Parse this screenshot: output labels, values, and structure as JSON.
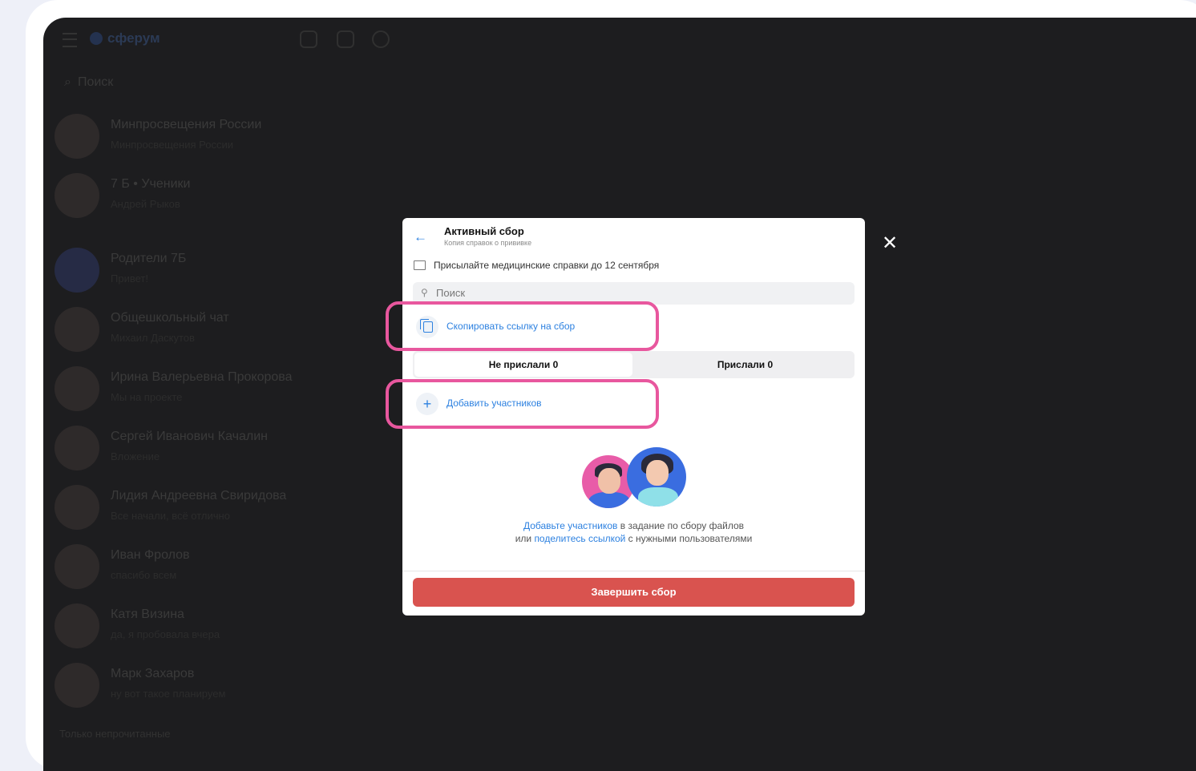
{
  "app": {
    "brand": "сферум"
  },
  "sidebar": {
    "search_placeholder": "Поиск",
    "chats": [
      {
        "name": "Минпросвещения России",
        "preview": "Минпросвещения России"
      },
      {
        "name": "7 Б • Ученики",
        "preview": "Андрей Рыков"
      },
      {
        "name": "Родители 7Б",
        "preview": "Привет!"
      },
      {
        "name": "Общешкольный чат",
        "preview": "Михаил Даскутов"
      },
      {
        "name": "Ирина Валерьевна Прокорова",
        "preview": "Мы на проекте"
      },
      {
        "name": "Сергей Иванович Качалин",
        "preview": "Вложение"
      },
      {
        "name": "Лидия Андреевна Свиридова",
        "preview": "Все начали, всё отлично"
      },
      {
        "name": "Иван Фролов",
        "preview": "спасибо всем"
      },
      {
        "name": "Катя Визина",
        "preview": "да, я пробовала вчера"
      },
      {
        "name": "Марк Захаров",
        "preview": "ну вот такое планируем"
      }
    ],
    "footer": "Только непрочитанные"
  },
  "modal": {
    "title": "Активный сбор",
    "subtitle": "Копия справок о прививке",
    "notice": "Присылайте медицинские справки до 12 сентября",
    "search_placeholder": "Поиск",
    "copy_link": "Скопировать ссылку на сбор",
    "tabs": {
      "not_sent": "Не прислали 0",
      "sent": "Прислали 0"
    },
    "add_participants": "Добавить участников",
    "info": {
      "link1": "Добавьте участников",
      "text1": " в задание по сбору файлов или ",
      "link2": "поделитесь ссылкой",
      "text2": " с нужными пользователями"
    },
    "finish_button": "Завершить сбор"
  },
  "icons": {
    "back": "arrow-left-icon",
    "close": "close-icon",
    "folder": "folder-icon",
    "search": "search-icon",
    "copy": "copy-icon",
    "plus": "plus-icon"
  },
  "colors": {
    "accent": "#2d81e0",
    "danger": "#d9534f",
    "highlight": "#e8579e",
    "overlay": "#1d1d1f"
  }
}
